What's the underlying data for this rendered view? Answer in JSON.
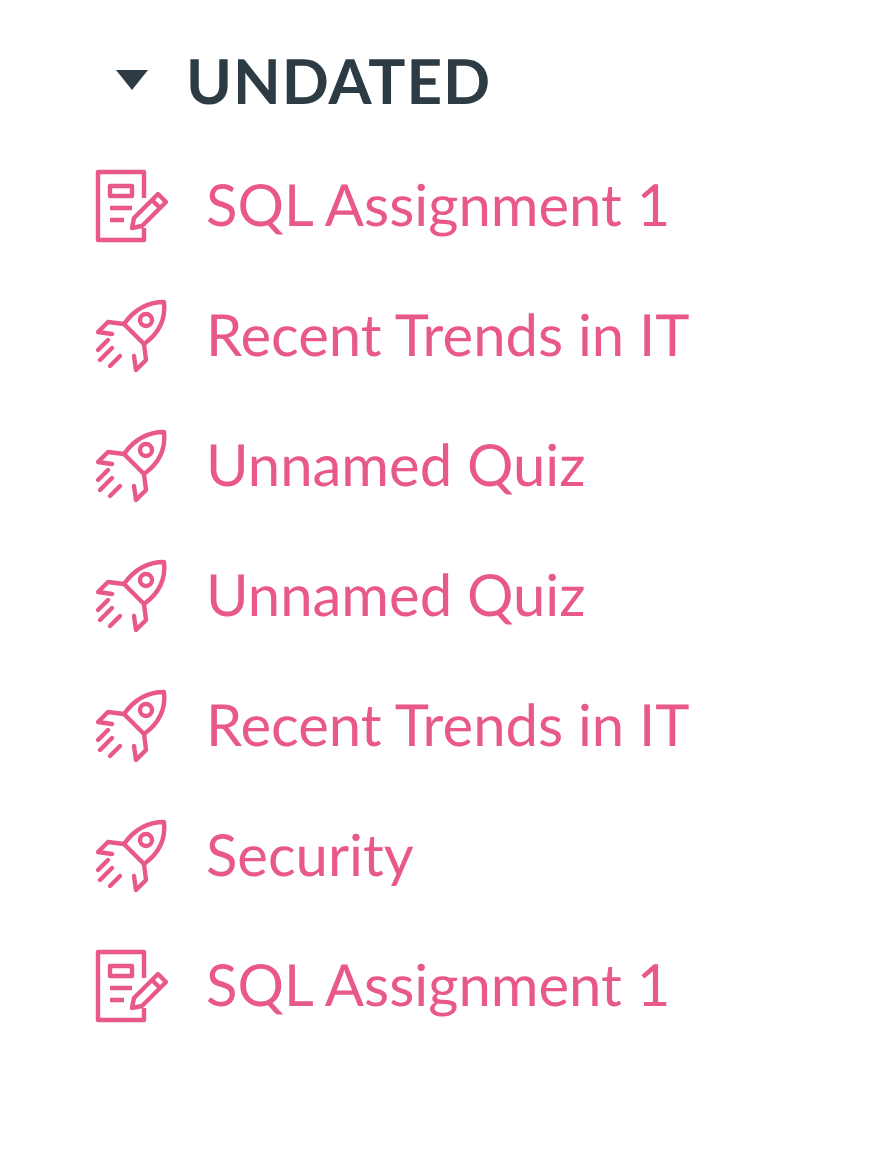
{
  "section": {
    "title": "UNDATED",
    "expanded": true,
    "items": [
      {
        "kind": "assignment",
        "label": "SQL Assignment 1"
      },
      {
        "kind": "quiz",
        "label": "Recent Trends in IT"
      },
      {
        "kind": "quiz",
        "label": "Unnamed Quiz"
      },
      {
        "kind": "quiz",
        "label": "Unnamed Quiz"
      },
      {
        "kind": "quiz",
        "label": "Recent Trends in IT"
      },
      {
        "kind": "quiz",
        "label": "Security"
      },
      {
        "kind": "assignment",
        "label": "SQL Assignment 1"
      }
    ]
  }
}
